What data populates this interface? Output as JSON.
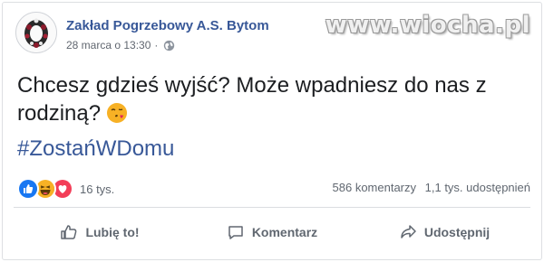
{
  "post": {
    "page_name": "Zakład Pogrzebowy A.S. Bytom",
    "date": "28 marca o 13:30",
    "separator": "·",
    "privacy_icon": "globe-icon",
    "text": "Chcesz gdzieś wyjść? Może wpadniesz do nas z rodziną?",
    "text_emoji": "face-blowing-kiss-emoji",
    "hashtag": "#ZostańWDomu"
  },
  "watermark": "www.wiocha.pl",
  "stats": {
    "reaction_icons": [
      "like-reaction-icon",
      "haha-reaction-icon",
      "love-reaction-icon"
    ],
    "reaction_count": "16 tys.",
    "comments": "586 komentarzy",
    "shares": "1,1 tys. udostępnień"
  },
  "actions": {
    "like": "Lubię to!",
    "comment": "Komentarz",
    "share": "Udostępnij"
  },
  "colors": {
    "link": "#385898",
    "text": "#1c1e21",
    "muted": "#606770",
    "like_blue": "#1877f2",
    "love_red": "#f33e58",
    "haha_yellow": "#f7b125"
  }
}
